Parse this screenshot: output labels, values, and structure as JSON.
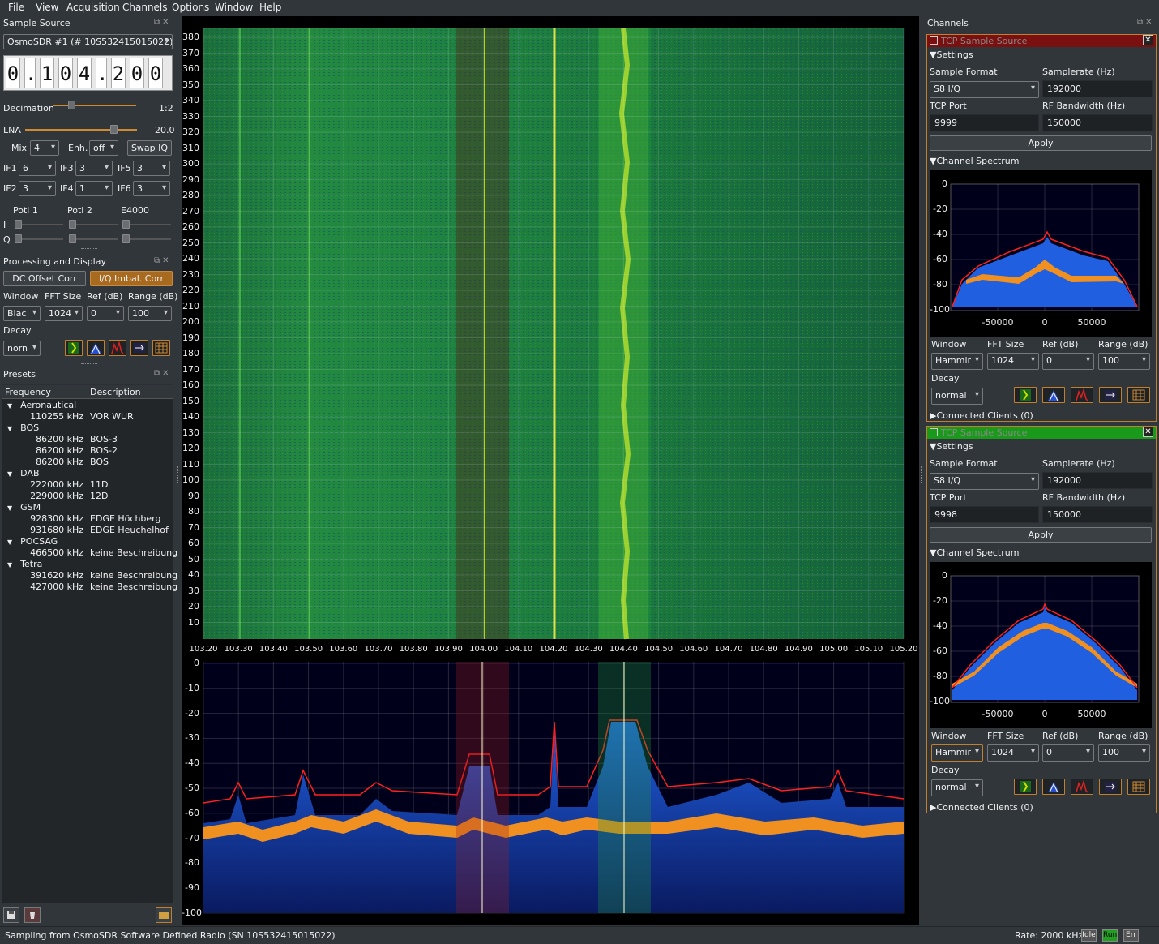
{
  "menu": [
    "File",
    "View",
    "Acquisition",
    "Channels",
    "Options",
    "Window",
    "Help"
  ],
  "sample_source": {
    "title": "Sample Source",
    "device": "OsmoSDR #1 (# 10S532415015022)",
    "freq_digits": [
      "0",
      ".",
      "1",
      "0",
      "4",
      ".",
      "2",
      "0",
      "0"
    ],
    "decimation_label": "Decimation",
    "decimation_value": "1:2",
    "lna_label": "LNA",
    "lna_value": "20.0",
    "mix_label": "Mix",
    "mix_value": "4",
    "enh_label": "Enh.",
    "enh_value": "off",
    "swap_iq": "Swap IQ",
    "if1_label": "IF1",
    "if1": "6",
    "if3_label": "IF3",
    "if3": "3",
    "if5_label": "IF5",
    "if5": "3",
    "if2_label": "IF2",
    "if2": "3",
    "if4_label": "IF4",
    "if4": "1",
    "if6_label": "IF6",
    "if6": "3",
    "poti1": "Poti 1",
    "poti2": "Poti 2",
    "e4000": "E4000",
    "i_label": "I",
    "q_label": "Q"
  },
  "processing": {
    "title": "Processing and Display",
    "dc_offset": "DC Offset Corr",
    "iq_imbal": "I/Q Imbal. Corr",
    "window_label": "Window",
    "fft_label": "FFT Size",
    "ref_label": "Ref (dB)",
    "range_label": "Range (dB)",
    "window_value": "Blac",
    "fft_value": "1024",
    "ref_value": "0",
    "range_value": "100",
    "decay_label": "Decay",
    "decay_value": "norn"
  },
  "presets": {
    "title": "Presets",
    "col_freq": "Frequency",
    "col_desc": "Description",
    "groups": [
      {
        "name": "Aeronautical",
        "items": [
          {
            "freq": "110255 kHz",
            "desc": "VOR WUR"
          }
        ]
      },
      {
        "name": "BOS",
        "items": [
          {
            "freq": "86200 kHz",
            "desc": "BOS-3"
          },
          {
            "freq": "86200 kHz",
            "desc": "BOS-2"
          },
          {
            "freq": "86200 kHz",
            "desc": "BOS"
          }
        ]
      },
      {
        "name": "DAB",
        "items": [
          {
            "freq": "222000 kHz",
            "desc": "11D"
          },
          {
            "freq": "229000 kHz",
            "desc": "12D"
          }
        ]
      },
      {
        "name": "GSM",
        "items": [
          {
            "freq": "928300 kHz",
            "desc": "EDGE Höchberg"
          },
          {
            "freq": "931680 kHz",
            "desc": "EDGE Heuchelhof"
          }
        ]
      },
      {
        "name": "POCSAG",
        "items": [
          {
            "freq": "466500 kHz",
            "desc": "keine Beschreibung"
          }
        ]
      },
      {
        "name": "Tetra",
        "items": [
          {
            "freq": "391620 kHz",
            "desc": "keine Beschreibung"
          },
          {
            "freq": "427000 kHz",
            "desc": "keine Beschreibung"
          }
        ]
      }
    ]
  },
  "waterfall": {
    "y_ticks": [
      "380",
      "370",
      "360",
      "350",
      "340",
      "330",
      "320",
      "310",
      "300",
      "290",
      "280",
      "270",
      "260",
      "250",
      "240",
      "230",
      "220",
      "210",
      "200",
      "190",
      "180",
      "170",
      "160",
      "150",
      "140",
      "130",
      "120",
      "110",
      "100",
      "90",
      "80",
      "70",
      "60",
      "50",
      "40",
      "30",
      "20",
      "10"
    ],
    "x_ticks": [
      "103.20",
      "103.30",
      "103.40",
      "103.50",
      "103.60",
      "103.70",
      "103.80",
      "103.90",
      "104.00",
      "104.10",
      "104.20",
      "104.30",
      "104.40",
      "104.50",
      "104.60",
      "104.70",
      "104.80",
      "104.90",
      "105.00",
      "105.10",
      "105.20"
    ]
  },
  "spectrum": {
    "y_ticks": [
      "0",
      "-10",
      "-20",
      "-30",
      "-40",
      "-50",
      "-60",
      "-70",
      "-80",
      "-90",
      "-100"
    ]
  },
  "channels": {
    "title": "Channels",
    "panels": [
      {
        "name": "TCP Sample Source",
        "header_color": "#7a1010",
        "settings": "Settings",
        "sample_format_label": "Sample Format",
        "sample_format": "S8 I/Q",
        "samplerate_label": "Samplerate (Hz)",
        "samplerate": "192000",
        "tcp_port_label": "TCP Port",
        "tcp_port": "9999",
        "rf_bw_label": "RF Bandwidth (Hz)",
        "rf_bw": "150000",
        "apply": "Apply",
        "channel_spectrum": "Channel Spectrum",
        "y_ticks": [
          "0",
          "-20",
          "-40",
          "-60",
          "-80",
          "-100"
        ],
        "x_ticks": [
          "-50000",
          "0",
          "50000"
        ],
        "window_label": "Window",
        "window": "Hammir",
        "fft_label": "FFT Size",
        "fft": "1024",
        "ref_label": "Ref (dB)",
        "ref": "0",
        "range_label": "Range (dB)",
        "range": "100",
        "decay_label": "Decay",
        "decay": "normal",
        "connected": "Connected Clients (0)"
      },
      {
        "name": "TCP Sample Source",
        "header_color": "#1a9a1a",
        "settings": "Settings",
        "sample_format_label": "Sample Format",
        "sample_format": "S8 I/Q",
        "samplerate_label": "Samplerate (Hz)",
        "samplerate": "192000",
        "tcp_port_label": "TCP Port",
        "tcp_port": "9998",
        "rf_bw_label": "RF Bandwidth (Hz)",
        "rf_bw": "150000",
        "apply": "Apply",
        "channel_spectrum": "Channel Spectrum",
        "y_ticks": [
          "0",
          "-20",
          "-40",
          "-60",
          "-80",
          "-100"
        ],
        "x_ticks": [
          "-50000",
          "0",
          "50000"
        ],
        "window_label": "Window",
        "window": "Hammir",
        "fft_label": "FFT Size",
        "fft": "1024",
        "ref_label": "Ref (dB)",
        "ref": "0",
        "range_label": "Range (dB)",
        "range": "100",
        "decay_label": "Decay",
        "decay": "normal",
        "connected": "Connected Clients (0)"
      }
    ]
  },
  "status": {
    "message": "Sampling from OsmoSDR Software Defined Radio (SN  10S532415015022)",
    "rate": "Rate: 2000 kHz",
    "idle": "Idle",
    "run": "Run",
    "err": "Err"
  }
}
